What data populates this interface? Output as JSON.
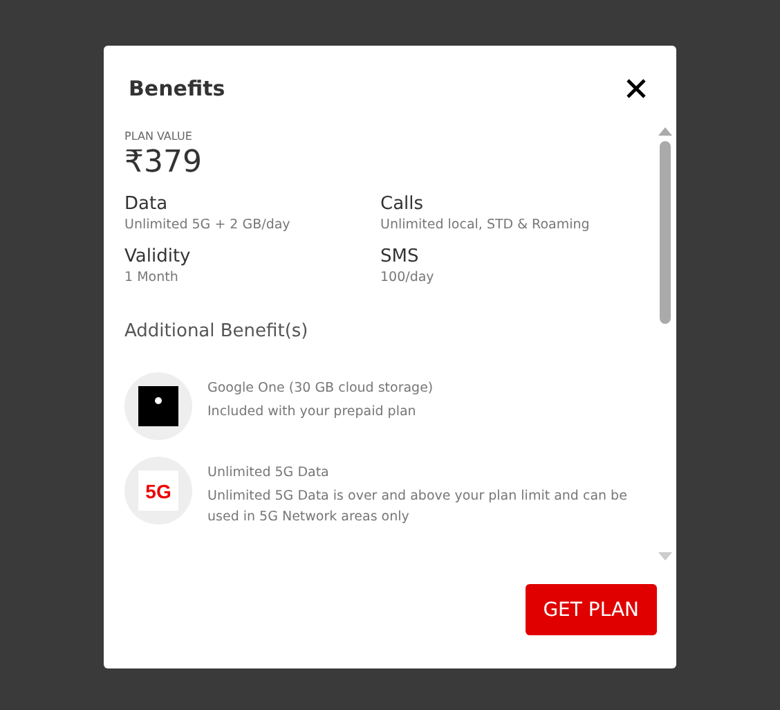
{
  "dialog": {
    "title": "Benefits"
  },
  "plan": {
    "label": "PLAN VALUE",
    "price": "₹379"
  },
  "details": [
    {
      "title": "Data",
      "value": "Unlimited 5G + 2 GB/day"
    },
    {
      "title": "Calls",
      "value": "Unlimited local, STD & Roaming"
    },
    {
      "title": "Validity",
      "value": "1 Month"
    },
    {
      "title": "SMS",
      "value": "100/day"
    }
  ],
  "additional": {
    "heading": "Additional Benefit(s)",
    "items": [
      {
        "kind": "logo",
        "title": "Google One (30 GB cloud storage)",
        "description": "Included with your prepaid plan"
      },
      {
        "kind": "badge",
        "badge": "5G",
        "title": "Unlimited 5G Data",
        "description": "Unlimited 5G Data is over and above your plan limit and can be used in 5G Network areas only"
      }
    ]
  },
  "button": "GET PLAN"
}
